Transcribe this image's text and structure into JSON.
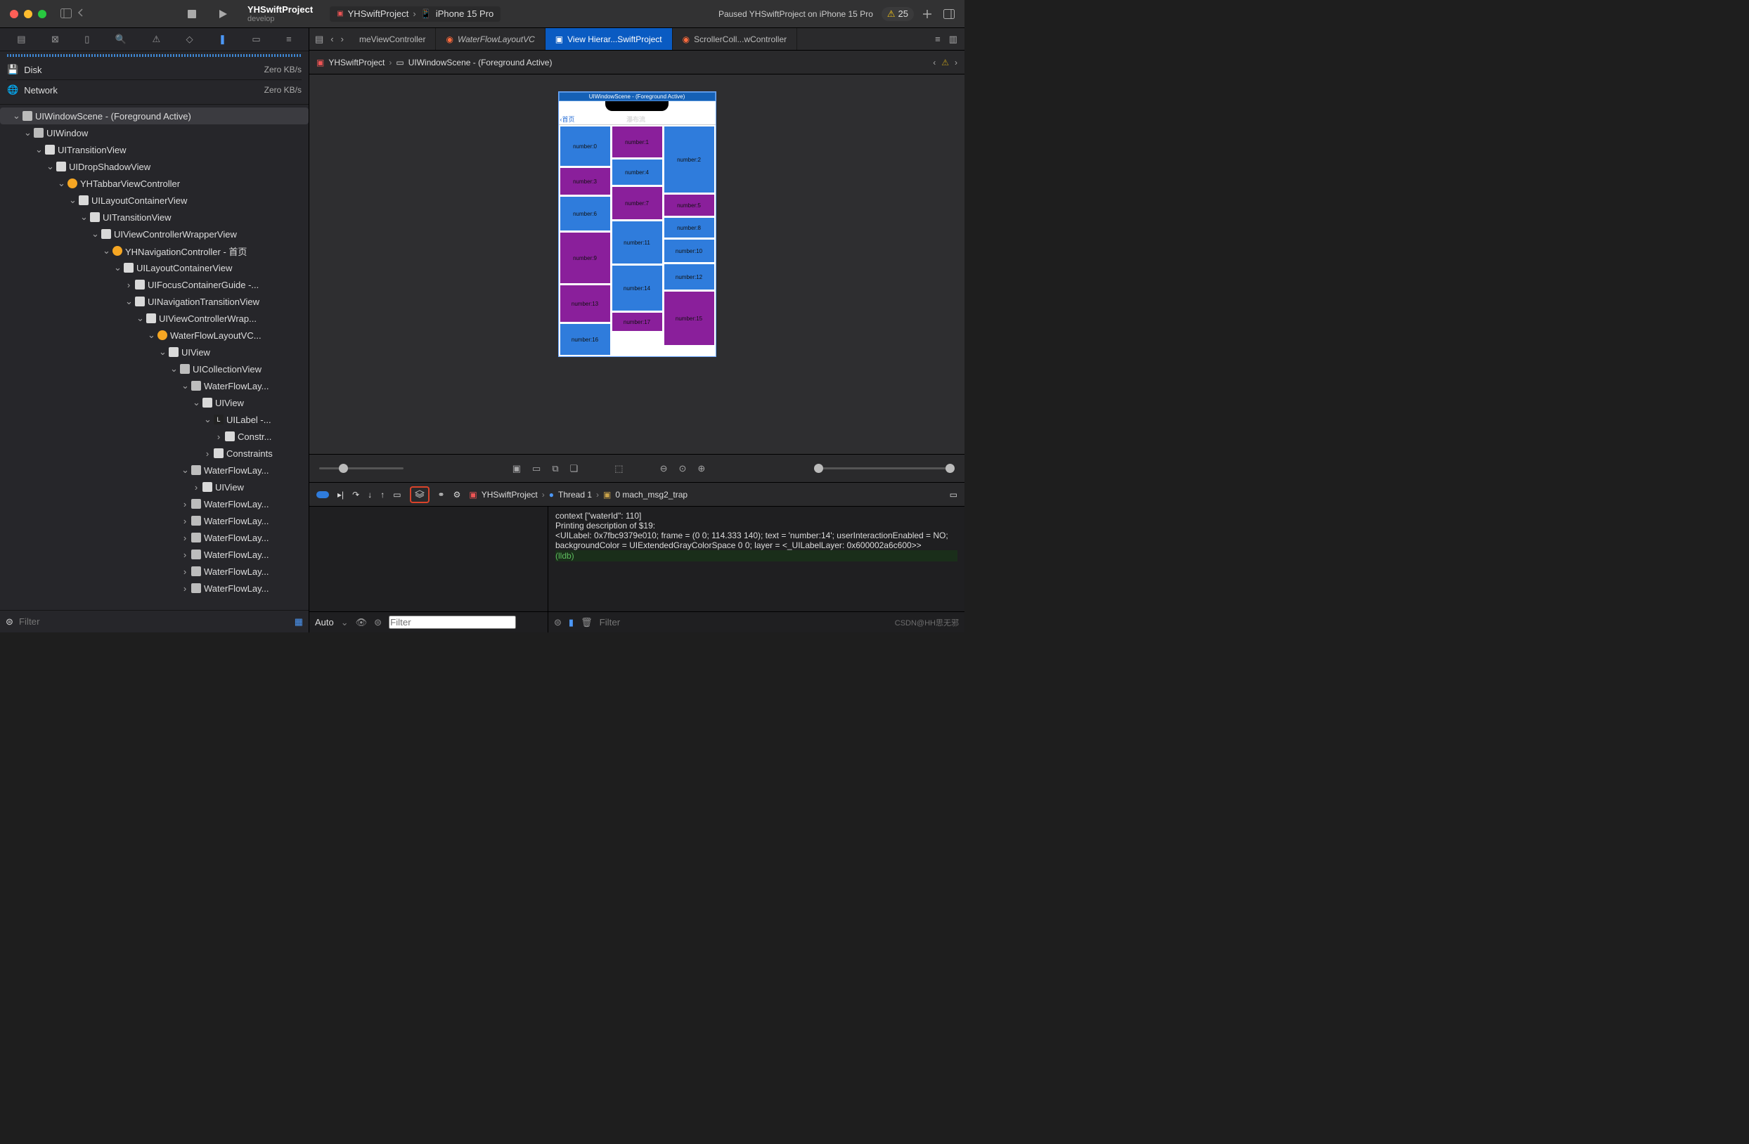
{
  "titlebar": {
    "project": "YHSwiftProject",
    "branch": "develop",
    "scheme": "YHSwiftProject",
    "device": "iPhone 15 Pro",
    "status": "Paused YHSwiftProject on iPhone 15 Pro",
    "warn_count": "25"
  },
  "metrics": {
    "disk_label": "Disk",
    "disk_value": "Zero KB/s",
    "net_label": "Network",
    "net_value": "Zero KB/s"
  },
  "tree": [
    {
      "d": 0,
      "t": "win",
      "open": true,
      "sel": true,
      "label": "UIWindowScene - (Foreground Active)"
    },
    {
      "d": 1,
      "t": "win",
      "open": true,
      "label": "UIWindow"
    },
    {
      "d": 2,
      "t": "view",
      "open": true,
      "label": "UITransitionView"
    },
    {
      "d": 3,
      "t": "view",
      "open": true,
      "label": "UIDropShadowView"
    },
    {
      "d": 4,
      "t": "ctrl",
      "open": true,
      "label": "YHTabbarViewController"
    },
    {
      "d": 5,
      "t": "view",
      "open": true,
      "label": "UILayoutContainerView"
    },
    {
      "d": 6,
      "t": "view",
      "open": true,
      "label": "UITransitionView"
    },
    {
      "d": 7,
      "t": "view",
      "open": true,
      "label": "UIViewControllerWrapperView"
    },
    {
      "d": 8,
      "t": "ctrl",
      "open": true,
      "label": "YHNavigationController - 首页"
    },
    {
      "d": 9,
      "t": "view",
      "open": true,
      "label": "UILayoutContainerView"
    },
    {
      "d": 10,
      "t": "view",
      "open": false,
      "closed": true,
      "label": "UIFocusContainerGuide -..."
    },
    {
      "d": 10,
      "t": "view",
      "open": true,
      "label": "UINavigationTransitionView"
    },
    {
      "d": 11,
      "t": "view",
      "open": true,
      "label": "UIViewControllerWrap..."
    },
    {
      "d": 12,
      "t": "ctrl",
      "open": true,
      "label": "WaterFlowLayoutVC..."
    },
    {
      "d": 13,
      "t": "view",
      "open": true,
      "label": "UIView"
    },
    {
      "d": 14,
      "t": "coll",
      "open": true,
      "label": "UICollectionView"
    },
    {
      "d": 15,
      "t": "coll",
      "open": true,
      "label": "WaterFlowLay..."
    },
    {
      "d": 16,
      "t": "view",
      "open": true,
      "label": "UIView"
    },
    {
      "d": 17,
      "t": "label",
      "open": true,
      "label": "UILabel -..."
    },
    {
      "d": 18,
      "t": "view",
      "open": false,
      "closed": true,
      "label": "Constr..."
    },
    {
      "d": 17,
      "t": "view",
      "open": false,
      "closed": true,
      "label": "Constraints"
    },
    {
      "d": 15,
      "t": "coll",
      "open": true,
      "label": "WaterFlowLay..."
    },
    {
      "d": 16,
      "t": "view",
      "open": false,
      "closed": true,
      "label": "UIView"
    },
    {
      "d": 15,
      "t": "coll",
      "open": false,
      "closed": true,
      "label": "WaterFlowLay..."
    },
    {
      "d": 15,
      "t": "coll",
      "open": false,
      "closed": true,
      "label": "WaterFlowLay..."
    },
    {
      "d": 15,
      "t": "coll",
      "open": false,
      "closed": true,
      "label": "WaterFlowLay..."
    },
    {
      "d": 15,
      "t": "coll",
      "open": false,
      "closed": true,
      "label": "WaterFlowLay..."
    },
    {
      "d": 15,
      "t": "coll",
      "open": false,
      "closed": true,
      "label": "WaterFlowLay..."
    },
    {
      "d": 15,
      "t": "coll",
      "open": false,
      "closed": true,
      "label": "WaterFlowLay..."
    }
  ],
  "sidebar_filter": "Filter",
  "tabs": {
    "t1": "meViewController",
    "t2": "WaterFlowLayoutVC",
    "t3": "View Hierar...SwiftProject",
    "t4": "ScrollerColl...wController"
  },
  "pathbar": {
    "p1": "YHSwiftProject",
    "p2": "UIWindowScene - (Foreground Active)"
  },
  "phone": {
    "scene_title": "UIWindowScene - (Foreground Active)",
    "back": "首页",
    "title": "瀑布流",
    "cols": [
      [
        {
          "c": "cblue",
          "h": 56,
          "t": "number:0"
        },
        {
          "c": "cpurple",
          "h": 38,
          "t": "number:3"
        },
        {
          "c": "cblue",
          "h": 48,
          "t": "number:6"
        },
        {
          "c": "cpurple",
          "h": 72,
          "t": "number:9"
        },
        {
          "c": "cpurple",
          "h": 52,
          "t": "number:13"
        },
        {
          "c": "cblue",
          "h": 44,
          "t": "number:16"
        }
      ],
      [
        {
          "c": "cpurple",
          "h": 44,
          "t": "number:1"
        },
        {
          "c": "cblue",
          "h": 36,
          "t": "number:4"
        },
        {
          "c": "cpurple",
          "h": 46,
          "t": "number:7"
        },
        {
          "c": "cblue",
          "h": 60,
          "t": "number:11"
        },
        {
          "c": "cblue",
          "h": 64,
          "t": "number:14"
        },
        {
          "c": "cpurple",
          "h": 26,
          "t": "number:17"
        }
      ],
      [
        {
          "c": "cblue",
          "h": 94,
          "t": "number:2"
        },
        {
          "c": "cpurple",
          "h": 30,
          "t": "number:5"
        },
        {
          "c": "cblue",
          "h": 28,
          "t": "number:8"
        },
        {
          "c": "cblue",
          "h": 32,
          "t": "number:10"
        },
        {
          "c": "cblue",
          "h": 36,
          "t": "number:12"
        },
        {
          "c": "cpurple",
          "h": 76,
          "t": "number:15"
        }
      ]
    ]
  },
  "debug_crumb": {
    "c1": "YHSwiftProject",
    "c2": "Thread 1",
    "c3": "0 mach_msg2_trap"
  },
  "console_lines": [
    "context [\"waterId\": 110]",
    "",
    "Printing description of $19:",
    "<UILabel: 0x7fbc9379e010; frame = (0 0; 114.333 140); text = 'number:14'; userInteractionEnabled = NO; backgroundColor = UIExtendedGrayColorSpace 0 0; layer = <_UILabelLayer: 0x600002a6c600>>"
  ],
  "lldb_prompt": "(lldb) ",
  "bottom": {
    "auto": "Auto",
    "filter": "Filter"
  },
  "watermark": "CSDN@HH思无邪"
}
